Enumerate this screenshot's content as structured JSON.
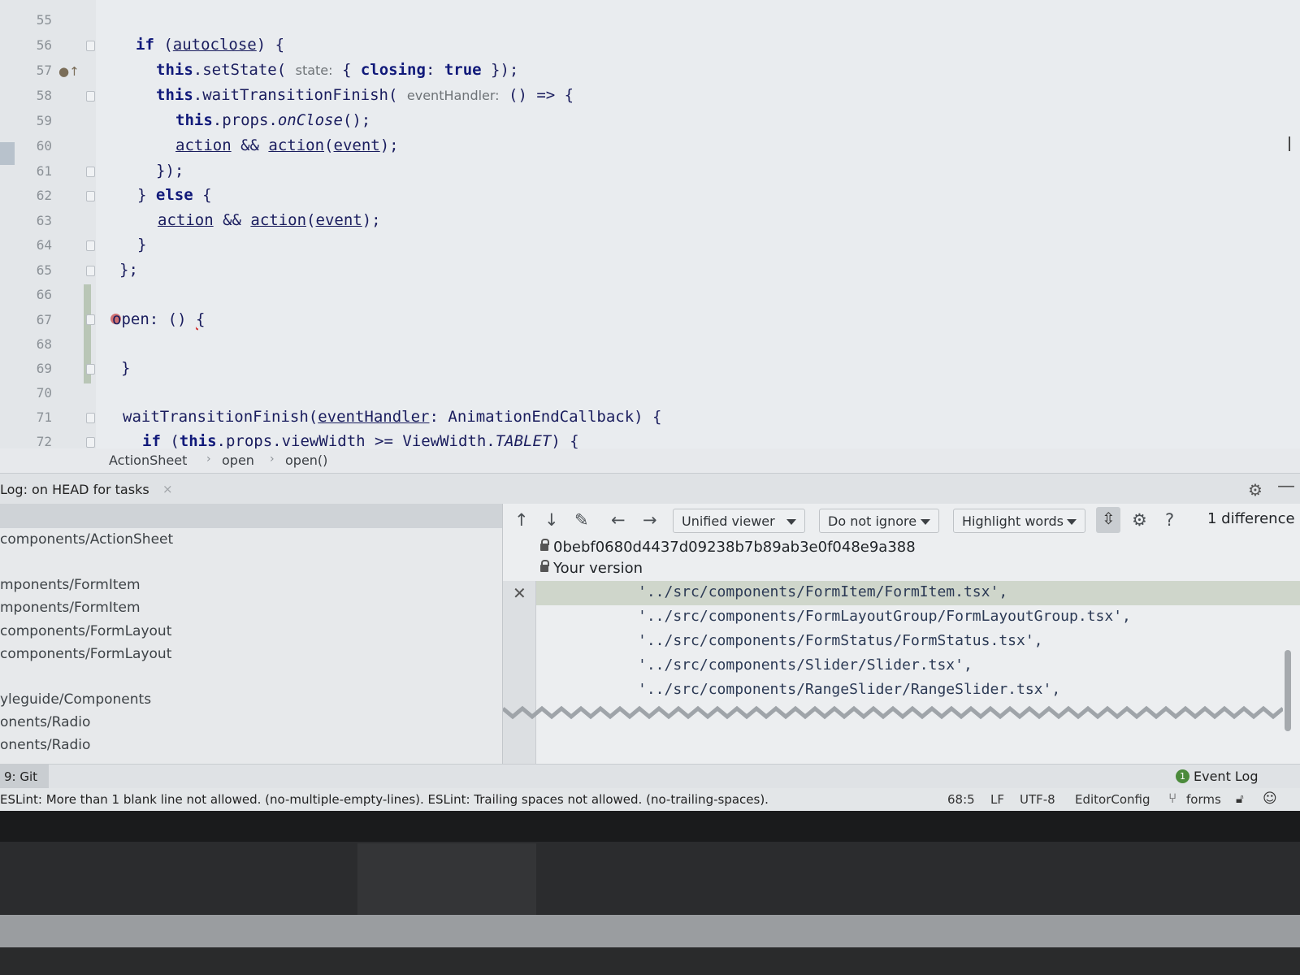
{
  "editor": {
    "lines": [
      {
        "num": "55"
      },
      {
        "num": "56"
      },
      {
        "num": "57"
      },
      {
        "num": "58"
      },
      {
        "num": "59"
      },
      {
        "num": "60"
      },
      {
        "num": "61"
      },
      {
        "num": "62"
      },
      {
        "num": "63"
      },
      {
        "num": "64"
      },
      {
        "num": "65"
      },
      {
        "num": "66"
      },
      {
        "num": "67"
      },
      {
        "num": "68"
      },
      {
        "num": "69"
      },
      {
        "num": "70"
      },
      {
        "num": "71"
      },
      {
        "num": "72"
      }
    ],
    "code": {
      "l56": {
        "kw": "if",
        "open": " (",
        "var": "autoclose",
        "close": ") {"
      },
      "l57": {
        "kw": "this",
        "call": ".setState(",
        "hint": "state:",
        "rest": " { ",
        "prop": "closing",
        "colon": ": ",
        "val": "true",
        "end": " });"
      },
      "l58": {
        "kw": "this",
        "call": ".waitTransitionFinish(",
        "hint": "eventHandler:",
        "rest": " () => {"
      },
      "l59": {
        "kw": "this",
        "call": ".props.",
        "fn": "onClose",
        "end": "();"
      },
      "l60": {
        "a": "action",
        "mid": " && ",
        "b": "action",
        "p1": "(",
        "c": "event",
        "p2": ");"
      },
      "l61": {
        "text": "});"
      },
      "l62": {
        "a": "} ",
        "kw": "else",
        "b": " {"
      },
      "l63": {
        "a": "action",
        "mid": " && ",
        "b": "action",
        "p1": "(",
        "c": "event",
        "p2": ");"
      },
      "l64": {
        "text": "}"
      },
      "l65": {
        "text": "};"
      },
      "l67": {
        "name": "open",
        "rest": ": () ",
        "brace": "{"
      },
      "l69": {
        "text": "}"
      },
      "l71": {
        "fn": "waitTransitionFinish(",
        "param": "eventHandler",
        "rest": ": AnimationEndCallback) {"
      },
      "l72": {
        "kw": "if",
        "a": " (",
        "kw2": "this",
        "b": ".props.viewWidth >= ViewWidth.",
        "c": "TABLET",
        "d": ") {"
      }
    },
    "breadcrumb": [
      "ActionSheet",
      "open",
      "open()"
    ]
  },
  "tool_window": {
    "title": "Log: on HEAD for tasks",
    "close_icon": "close-icon",
    "file_paths": [
      "components/ActionSheet",
      "mponents/FormItem",
      "mponents/FormItem",
      "components/FormLayout",
      "components/FormLayout",
      "yleguide/Components",
      "onents/Radio",
      "onents/Radio"
    ],
    "diff": {
      "toolbar": {
        "viewer": "Unified viewer",
        "ignore": "Do not ignore",
        "highlight": "Highlight words",
        "count": "1 difference"
      },
      "hash": "0bebf0680d4437d09238b7b89ab3e0f048e9a388",
      "your_version": "Your version",
      "lines": [
        "'../src/components/FormItem/FormItem.tsx',",
        "'../src/components/FormLayoutGroup/FormLayoutGroup.tsx',",
        "'../src/components/FormStatus/FormStatus.tsx',",
        "'../src/components/Slider/Slider.tsx',",
        "'../src/components/RangeSlider/RangeSlider.tsx',"
      ]
    }
  },
  "git_bar": {
    "tab": "9: Git",
    "event_log_count": "1",
    "event_log": "Event Log"
  },
  "status_bar": {
    "message": "ESLint: More than 1 blank line not allowed. (no-multiple-empty-lines). ESLint: Trailing spaces not allowed. (no-trailing-spaces).",
    "position": "68:5",
    "line_sep": "LF",
    "encoding": "UTF-8",
    "config": "EditorConfig",
    "branch": "forms"
  },
  "colors": {
    "accent_green": "#4b8a3b",
    "error_red": "#c74848"
  }
}
